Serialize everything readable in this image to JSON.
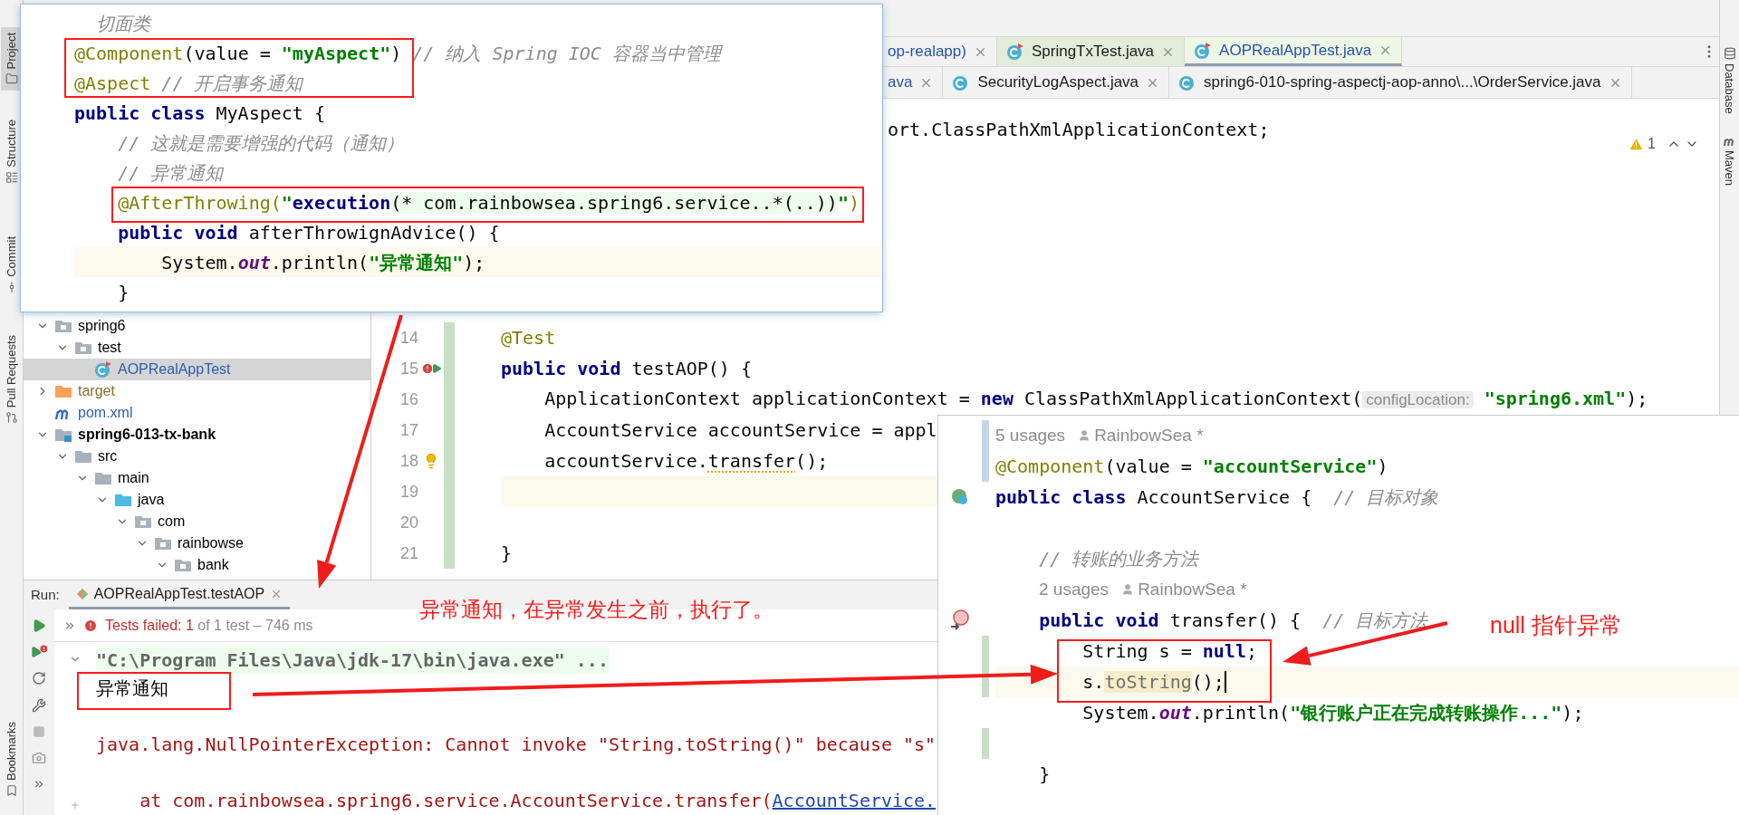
{
  "left_tool_strip": [
    {
      "label": "Project",
      "selected": true
    },
    {
      "label": "Structure",
      "selected": false
    },
    {
      "label": "Commit",
      "selected": false
    },
    {
      "label": "Pull Requests",
      "selected": false
    },
    {
      "label": "Bookmarks",
      "selected": false
    }
  ],
  "right_tool_strip": [
    {
      "label": "Database",
      "kind": "database"
    },
    {
      "label": "Maven",
      "kind": "maven"
    }
  ],
  "editor_tabs": [
    [
      {
        "label": "op-realapp)",
        "selected": false,
        "kind": "partial"
      },
      {
        "label": "SpringTxTest.java",
        "selected": false,
        "kind": "test"
      },
      {
        "label": "AOPRealAppTest.java",
        "selected": true,
        "kind": "test"
      }
    ],
    [
      {
        "label": "ava",
        "selected": false,
        "kind": "partial"
      },
      {
        "label": "SecurityLogAspect.java",
        "selected": false,
        "kind": "class"
      },
      {
        "label": "spring6-010-spring-aspectj-aop-anno\\...\\OrderService.java",
        "selected": false,
        "kind": "class"
      }
    ]
  ],
  "project_tree": [
    {
      "label": "spring6",
      "kind": "package",
      "selected": false,
      "expanded": true,
      "children": [
        {
          "label": "test",
          "kind": "package",
          "selected": false,
          "expanded": true,
          "children": [
            {
              "label": "AOPRealAppTest",
              "kind": "test-class",
              "selected": true
            }
          ]
        }
      ]
    },
    {
      "label": "target",
      "kind": "excluded-folder",
      "selected": false,
      "expanded": false
    },
    {
      "label": "pom.xml",
      "kind": "maven",
      "selected": false
    },
    {
      "label": "spring6-013-tx-bank",
      "kind": "module",
      "selected": false,
      "expanded": true,
      "children": [
        {
          "label": "src",
          "kind": "folder",
          "selected": false,
          "expanded": true,
          "children": [
            {
              "label": "main",
              "kind": "folder",
              "selected": false,
              "expanded": true,
              "children": [
                {
                  "label": "java",
                  "kind": "source-folder",
                  "selected": false,
                  "expanded": true,
                  "children": [
                    {
                      "label": "com",
                      "kind": "package",
                      "selected": false,
                      "expanded": true,
                      "children": [
                        {
                          "label": "rainbowse",
                          "kind": "package",
                          "selected": false,
                          "expanded": true,
                          "children": [
                            {
                              "label": "bank",
                              "kind": "package",
                              "selected": false,
                              "expanded": true
                            }
                          ]
                        }
                      ]
                    }
                  ]
                }
              ]
            }
          ]
        }
      ]
    }
  ],
  "editor": {
    "top_line": [
      {
        "text": "ort.ClassPathXmlApplicationContext;",
        "kind": "plain"
      }
    ],
    "problems": "1",
    "lines": [
      {
        "number": "14",
        "current": false,
        "segments": [
          {
            "text": "@Test",
            "kind": "annotation"
          }
        ]
      },
      {
        "number": "15",
        "current": false,
        "test_failed": true,
        "segments": [
          {
            "text": "public void",
            "kind": "keyword"
          },
          {
            "text": " testAOP() {",
            "kind": "plain"
          }
        ]
      },
      {
        "number": "16",
        "current": false,
        "segments": [
          {
            "text": "    ApplicationContext applicationContext = ",
            "kind": "plain"
          },
          {
            "text": "new",
            "kind": "keyword"
          },
          {
            "text": " ClassPathXmlApplicationContext(",
            "kind": "plain"
          },
          {
            "text": "configLocation:",
            "kind": "hint"
          },
          {
            "text": " \"spring6.xml\"",
            "kind": "string"
          },
          {
            "text": ");",
            "kind": "plain"
          }
        ]
      },
      {
        "number": "17",
        "current": false,
        "segments": [
          {
            "text": "    AccountService accountService = appl",
            "kind": "plain"
          }
        ]
      },
      {
        "number": "18",
        "current": false,
        "intention": true,
        "segments": [
          {
            "text": "    accountService.",
            "kind": "plain"
          },
          {
            "text": "transfer",
            "kind": "warning"
          },
          {
            "text": "();",
            "kind": "plain"
          }
        ]
      },
      {
        "number": "19",
        "current": true
      },
      {
        "number": "20",
        "current": false
      },
      {
        "number": "21",
        "current": false,
        "segments": [
          {
            "text": "}",
            "kind": "plain"
          }
        ]
      }
    ]
  },
  "run_panel": {
    "label": "Run:",
    "tab": "AOPRealAppTest.testAOP",
    "status": [
      {
        "text": "Tests failed: 1",
        "kind": "failed"
      },
      {
        "text": " of 1 test – 746 ms",
        "kind": "info"
      }
    ],
    "console": [
      {
        "kind": "command",
        "text": "\"C:\\Program Files\\Java\\jdk-17\\bin\\java.exe\" ..."
      },
      {
        "kind": "output",
        "text": "异常通知"
      },
      {
        "kind": "blank"
      },
      {
        "kind": "error",
        "text": "java.lang.NullPointerException: Cannot invoke \"String.toString()\" because \"s\""
      },
      {
        "kind": "blank"
      },
      {
        "kind": "trace",
        "text": "    at com.rainbowsea.spring6.service.AccountService.transfer(",
        "link": "AccountService."
      }
    ]
  },
  "aspect_popup": {
    "lines": [
      {
        "current": false,
        "segments": [
          {
            "text": "  切面类",
            "kind": "comment"
          }
        ]
      },
      {
        "current": false,
        "segments": [
          {
            "text": "@Component",
            "kind": "annotation"
          },
          {
            "text": "(value = ",
            "kind": "plain"
          },
          {
            "text": "\"myAspect\"",
            "kind": "string"
          },
          {
            "text": ")",
            "kind": "plain"
          },
          {
            "text": " // 纳入 Spring IOC 容器当中管理",
            "kind": "comment"
          }
        ]
      },
      {
        "current": false,
        "segments": [
          {
            "text": "@Aspect",
            "kind": "annotation"
          },
          {
            "text": " // 开启事务通知",
            "kind": "comment"
          }
        ]
      },
      {
        "current": false,
        "segments": [
          {
            "text": "public class",
            "kind": "keyword"
          },
          {
            "text": " MyAspect {",
            "kind": "plain"
          }
        ]
      },
      {
        "current": false,
        "segments": [
          {
            "text": "    // 这就是需要增强的代码（通知）",
            "kind": "comment"
          }
        ]
      },
      {
        "current": false,
        "segments": [
          {
            "text": "    // 异常通知",
            "kind": "comment"
          }
        ]
      },
      {
        "current": false,
        "segments": [
          {
            "text": "    @AfterThrowing(",
            "kind": "annotation"
          },
          {
            "text": "\"",
            "kind": "string"
          },
          {
            "text": "execution",
            "kind": "keyword"
          },
          {
            "text": "(* com.rainbowsea.spring6.service..*(..))",
            "kind": "injected"
          },
          {
            "text": "\"",
            "kind": "string"
          },
          {
            "text": ")",
            "kind": "annotation"
          }
        ]
      },
      {
        "current": false,
        "segments": [
          {
            "text": "    public void",
            "kind": "keyword"
          },
          {
            "text": " afterThrowignAdvice() {",
            "kind": "plain"
          }
        ]
      },
      {
        "current": true,
        "segments": [
          {
            "text": "        System.",
            "kind": "plain"
          },
          {
            "text": "out",
            "kind": "field"
          },
          {
            "text": ".println(",
            "kind": "plain"
          },
          {
            "text": "\"异常通知\"",
            "kind": "string"
          },
          {
            "text": ");",
            "kind": "plain"
          }
        ]
      },
      {
        "current": false,
        "segments": [
          {
            "text": "    }",
            "kind": "plain"
          }
        ]
      }
    ]
  },
  "service_popup": {
    "lines": [
      {
        "kind": "usages",
        "usages": "5 usages",
        "author": "RainbowSea *",
        "modified": true
      },
      {
        "kind": "code",
        "current": false,
        "modified": true,
        "segments": [
          {
            "text": "@Component",
            "kind": "annotation"
          },
          {
            "text": "(value = ",
            "kind": "plain"
          },
          {
            "text": "\"accountService\"",
            "kind": "string"
          },
          {
            "text": ")",
            "kind": "plain"
          }
        ]
      },
      {
        "kind": "code",
        "current": false,
        "bean": true,
        "segments": [
          {
            "text": "public class",
            "kind": "keyword"
          },
          {
            "text": " AccountService {  ",
            "kind": "plain"
          },
          {
            "text": "// 目标对象",
            "kind": "comment"
          }
        ]
      },
      {
        "kind": "code",
        "current": false
      },
      {
        "kind": "code",
        "current": false,
        "segments": [
          {
            "text": "    // 转账的业务方法",
            "kind": "comment"
          }
        ]
      },
      {
        "kind": "usages",
        "indented": true,
        "usages": "2 usages",
        "author": "RainbowSea *"
      },
      {
        "kind": "code",
        "current": false,
        "method_marker": true,
        "segments": [
          {
            "text": "    public void",
            "kind": "keyword"
          },
          {
            "text": " transfer() {  ",
            "kind": "plain"
          },
          {
            "text": "// 目标方法",
            "kind": "comment"
          }
        ]
      },
      {
        "kind": "code",
        "current": false,
        "added": true,
        "segments": [
          {
            "text": "        String s = ",
            "kind": "plain"
          },
          {
            "text": "null",
            "kind": "keyword"
          },
          {
            "text": ";",
            "kind": "plain"
          }
        ]
      },
      {
        "kind": "code",
        "current": true,
        "caret": true,
        "added": true,
        "segments": [
          {
            "text": "        s.",
            "kind": "plain"
          },
          {
            "text": "toString",
            "kind": "marked"
          },
          {
            "text": "();",
            "kind": "plain"
          }
        ]
      },
      {
        "kind": "code",
        "current": false,
        "segments": [
          {
            "text": "        System.",
            "kind": "plain"
          },
          {
            "text": "out",
            "kind": "field"
          },
          {
            "text": ".println(",
            "kind": "plain"
          },
          {
            "text": "\"银行账户正在完成转账操作...\"",
            "kind": "string"
          },
          {
            "text": ");",
            "kind": "plain"
          }
        ]
      },
      {
        "kind": "code",
        "current": false,
        "added": true
      },
      {
        "kind": "code",
        "current": false,
        "segments": [
          {
            "text": "    }",
            "kind": "plain"
          }
        ]
      }
    ]
  },
  "annotations": [
    {
      "text": "异常通知，在异常发生之前，执行了。"
    },
    {
      "text": "null 指针异常"
    }
  ]
}
